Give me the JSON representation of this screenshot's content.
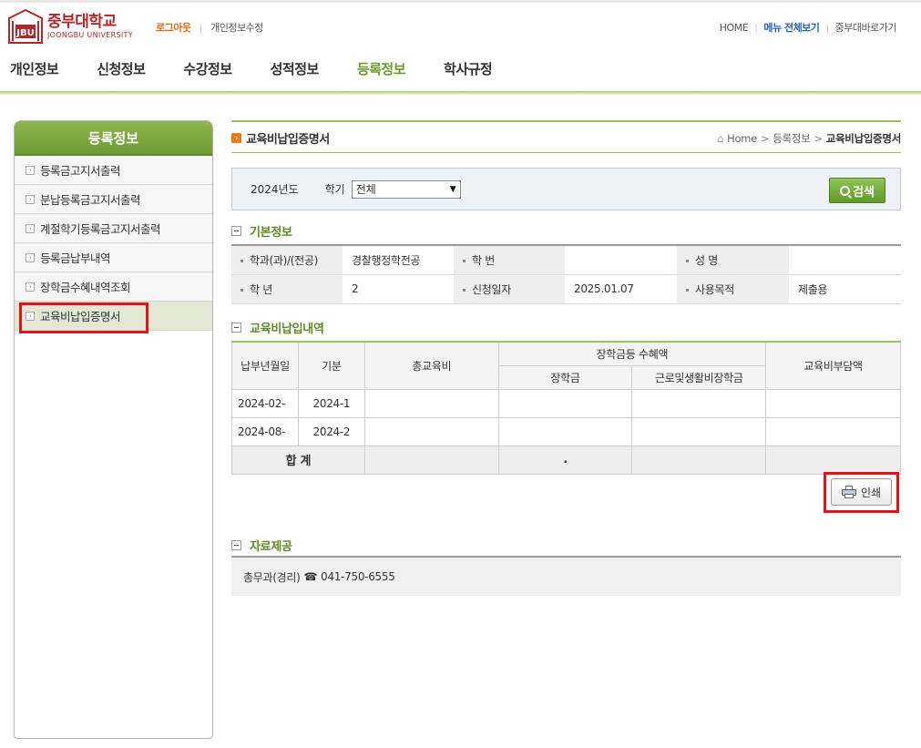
{
  "header": {
    "logo_kr": "중부대학교",
    "logo_en": "JOONGBU UNIVERSITY",
    "logo_emblem_text": "JBU",
    "logout": "로그아웃",
    "edit_profile": "개인정보수정",
    "home": "HOME",
    "menu_all": "메뉴 전체보기",
    "shortcut": "중부대바로가기"
  },
  "gnb": [
    "개인정보",
    "신청정보",
    "수강정보",
    "성적정보",
    "등록정보",
    "학사규정"
  ],
  "sidebar": {
    "title": "등록정보",
    "items": [
      "등록금고지서출력",
      "분납등록금고지서출력",
      "계절학기등록금고지서출력",
      "등록금납부내역",
      "장학금수혜내역조회",
      "교육비납입증명서"
    ]
  },
  "page": {
    "title": "교육비납입증명서",
    "breadcrumb": [
      "Home",
      "등록정보",
      "교육비납입증명서"
    ]
  },
  "search": {
    "year": "2024년도",
    "term_label": "학기",
    "term_value": "전체",
    "search_button": "검색"
  },
  "basic_info": {
    "section_title": "기본정보",
    "labels": {
      "dept": "학과(과)/(전공)",
      "student_no": "학 번",
      "name": "성 명",
      "grade": "학 년",
      "apply_date": "신청일자",
      "purpose": "사용목적"
    },
    "values": {
      "dept": "경찰행정학전공",
      "student_no": "",
      "name": "",
      "grade": "2",
      "apply_date": "2025.01.07",
      "purpose": "제출용"
    }
  },
  "payment": {
    "section_title": "교육비납입내역",
    "headers": {
      "date": "납부년월일",
      "term": "기분",
      "total": "총교육비",
      "scholarship_group": "장학금등 수혜액",
      "scholarship": "장학금",
      "work_scholarship": "근로및생활비장학금",
      "burden": "교육비부담액"
    },
    "rows": [
      {
        "date": "2024-02-",
        "term": "2024-1"
      },
      {
        "date": "2024-08-",
        "term": "2024-2"
      }
    ],
    "total_label": "합 계",
    "total_scholarship": "."
  },
  "print_button": "인쇄",
  "provide": {
    "section_title": "자료제공",
    "dept": "총무과(경리)",
    "phone": "041-750-6555"
  },
  "colors": {
    "accent_green": "#6b9a2c",
    "brand_red": "#b0282a",
    "highlight_red": "#e0141e"
  }
}
